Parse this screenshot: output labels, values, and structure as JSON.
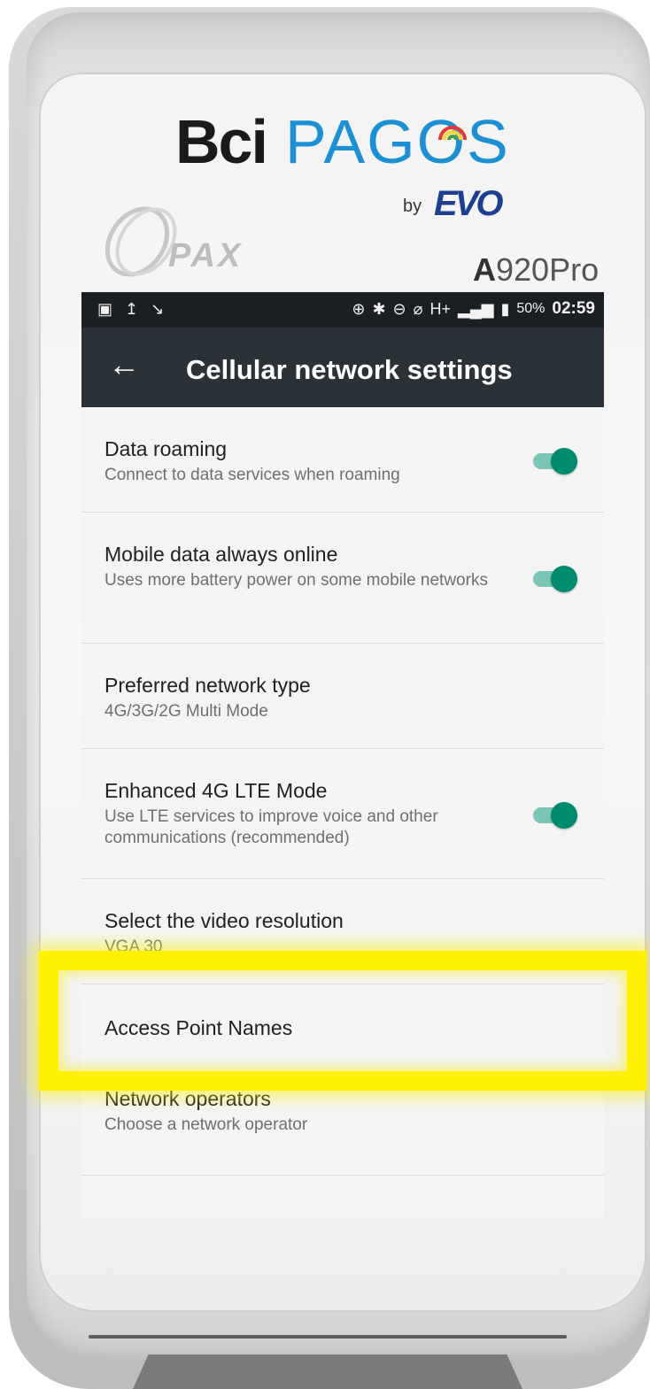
{
  "branding": {
    "bci": "Bci",
    "pagos": "PAGOS",
    "by": "by",
    "evo": "EVO",
    "pax": "PAX",
    "model_bold": "A",
    "model_rest": "920Pro"
  },
  "status_bar": {
    "left_icons": [
      "image-icon",
      "upload-icon",
      "missed-call-icon"
    ],
    "right_icons": [
      "data-saver-icon",
      "bluetooth-icon",
      "do-not-disturb-icon",
      "wifi-off-icon"
    ],
    "network": "H+",
    "battery": "50%",
    "time": "02:59"
  },
  "app_bar": {
    "back_icon": "arrow-left-icon",
    "title": "Cellular network settings"
  },
  "settings": [
    {
      "title": "Data roaming",
      "subtitle": "Connect to data services when roaming",
      "toggle": true,
      "toggle_on": true
    },
    {
      "title": "Mobile data always online",
      "subtitle": "Uses more battery power on some mobile networks",
      "toggle": true,
      "toggle_on": true
    },
    {
      "title": "Preferred network type",
      "subtitle": "4G/3G/2G Multi Mode",
      "toggle": false
    },
    {
      "title": "Enhanced 4G LTE Mode",
      "subtitle": "Use LTE services to improve voice and other communications (recommended)",
      "toggle": true,
      "toggle_on": true
    },
    {
      "title": "Select the video resolution",
      "subtitle": "VGA 30",
      "toggle": false
    },
    {
      "title": "Access Point Names",
      "subtitle": "",
      "toggle": false
    },
    {
      "title": "Network operators",
      "subtitle": "Choose a network operator",
      "toggle": false
    }
  ],
  "highlight": {
    "target": "Access Point Names",
    "color": "#fff200"
  },
  "colors": {
    "accent": "#008a6e",
    "app_bar": "#2a3137",
    "status_bar": "#1b1f23",
    "pagos_blue": "#1d8fd3"
  }
}
